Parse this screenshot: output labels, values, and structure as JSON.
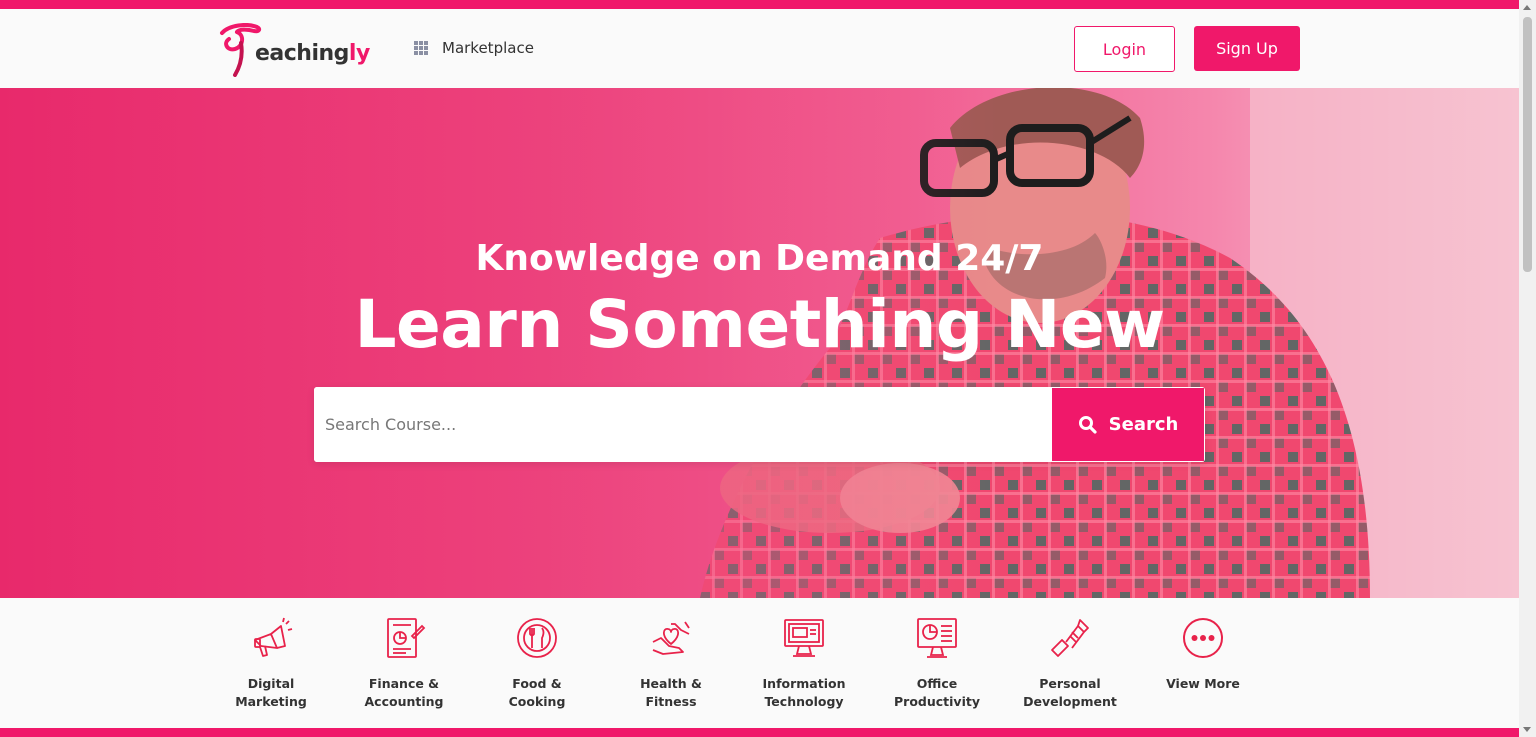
{
  "colors": {
    "brand": "#f0186a",
    "text": "#333333"
  },
  "header": {
    "logo": {
      "text_main": "eaching",
      "text_accent": "ly"
    },
    "marketplace_label": "Marketplace",
    "login_label": "Login",
    "signup_label": "Sign Up"
  },
  "hero": {
    "subtitle": "Knowledge on Demand 24/7",
    "title": "Learn Something New",
    "search": {
      "placeholder": "Search Course...",
      "button_label": "Search"
    }
  },
  "categories": [
    {
      "label": "Digital\nMarketing",
      "icon": "megaphone-icon"
    },
    {
      "label": "Finance &\nAccounting",
      "icon": "finance-icon"
    },
    {
      "label": "Food &\nCooking",
      "icon": "plate-cutlery-icon"
    },
    {
      "label": "Health &\nFitness",
      "icon": "heart-hands-icon"
    },
    {
      "label": "Information\nTechnology",
      "icon": "computer-icon"
    },
    {
      "label": "Office\nProductivity",
      "icon": "office-chart-icon"
    },
    {
      "label": "Personal\nDevelopment",
      "icon": "handshake-icon"
    },
    {
      "label": "View More",
      "icon": "more-dots-icon"
    }
  ]
}
